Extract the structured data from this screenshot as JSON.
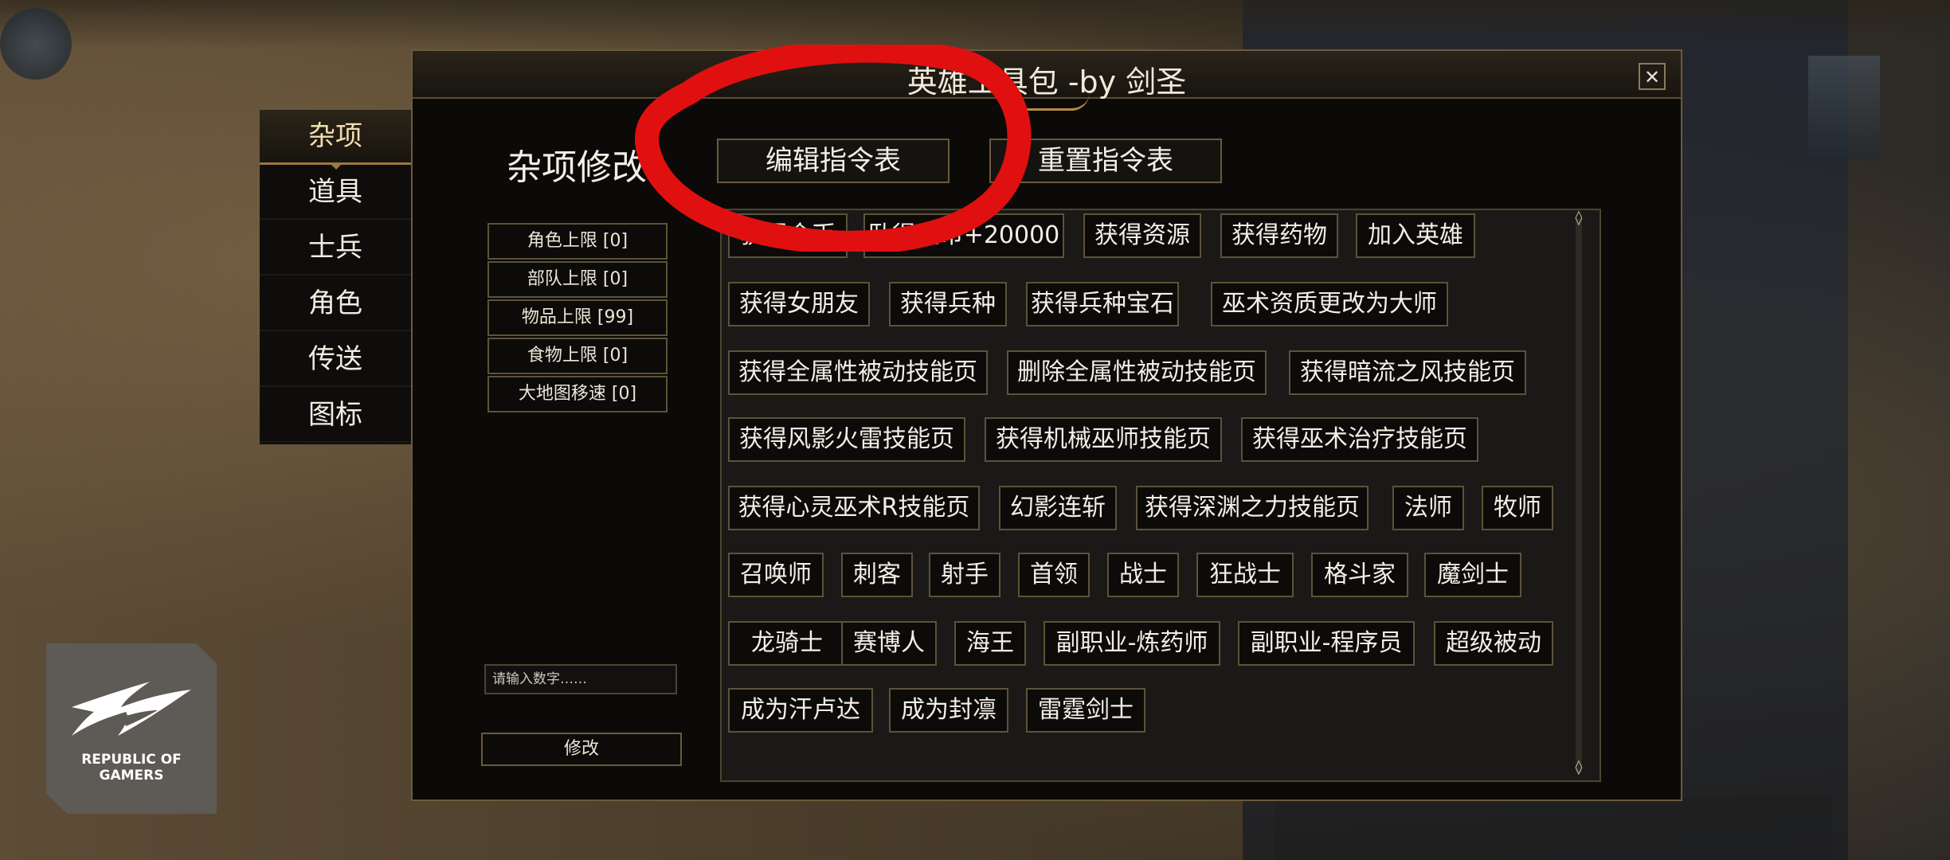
{
  "window": {
    "title": "英雄工具包 -by 剑圣",
    "close_symbol": "✕"
  },
  "sidebar": {
    "items": [
      {
        "label": "杂项",
        "active": true
      },
      {
        "label": "道具"
      },
      {
        "label": "士兵"
      },
      {
        "label": "角色"
      },
      {
        "label": "传送"
      },
      {
        "label": "图标"
      }
    ]
  },
  "main": {
    "section_title": "杂项修改",
    "edit_table_label": "编辑指令表",
    "reset_table_label": "重置指令表",
    "limits": [
      "角色上限 [0]",
      "部队上限 [0]",
      "物品上限 [99]",
      "食物上限 [0]",
      "大地图移速 [0]"
    ],
    "input_placeholder": "请输入数字……",
    "modify_label": "修改"
  },
  "commands": [
    "获得金币",
    "卧得金币+20000",
    "获得资源",
    "获得药物",
    "加入英雄",
    "获得女朋友",
    "获得兵种",
    "获得兵种宝石",
    "巫术资质更改为大师",
    "获得全属性被动技能页",
    "删除全属性被动技能页",
    "获得暗流之风技能页",
    "获得风影火雷技能页",
    "获得机械巫师技能页",
    "获得巫术治疗技能页",
    "获得心灵巫术R技能页",
    "幻影连斩",
    "获得深渊之力技能页",
    "法师",
    "牧师",
    "召唤师",
    "刺客",
    "射手",
    "首领",
    "战士",
    "狂战士",
    "格斗家",
    "魔剑士",
    "龙骑士",
    "赛博人",
    "海王",
    "副职业-炼药师",
    "副职业-程序员",
    "超级被动",
    "成为汗卢达",
    "成为封凛",
    "雷霆剑士"
  ],
  "scroll": {
    "up": "◊",
    "down": "◊"
  },
  "logo": {
    "line1": "REPUBLIC OF",
    "line2": "GAMERS"
  },
  "colors": {
    "annotation": "#e01010",
    "border_gold": "#6b5a3c",
    "panel_bg": "#0b0a08"
  },
  "icons": [
    "close-icon",
    "rog-logo-icon",
    "scroll-up-icon",
    "scroll-down-icon"
  ]
}
